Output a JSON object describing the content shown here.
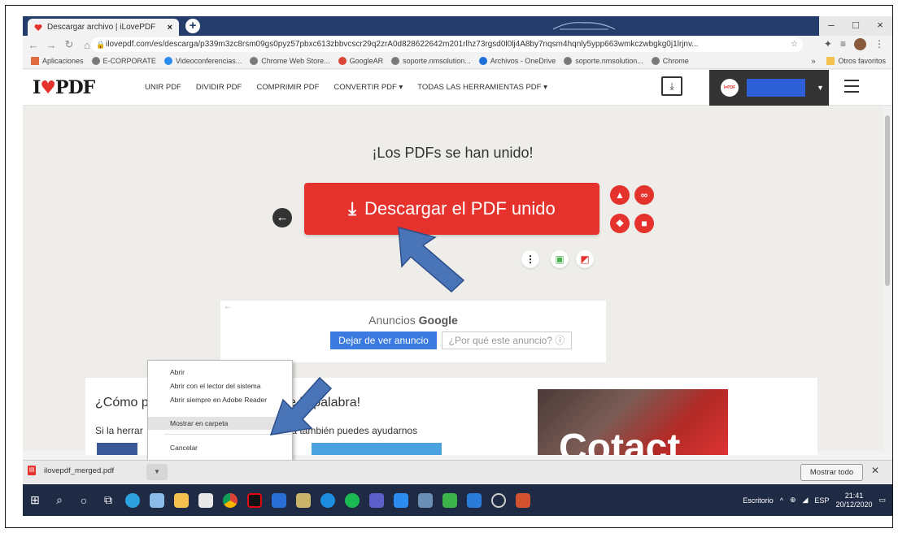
{
  "browser": {
    "tab_title": "Descargar archivo | iLovePDF",
    "new_tab": "+",
    "url": "ilovepdf.com/es/descarga/p339m3zc8rsm09gs0pyz57pbxc613zbbvcscr29q2zrA0d828622642m201rlhz73rgsd0l0lj4A8by7nqsm4hqnly5ypp663wmkczwbgkg0j1lrjnv...",
    "window_controls": {
      "min": "–",
      "max": "□",
      "close": "×"
    },
    "bookmarks": [
      "Aplicaciones",
      "E-CORPORATE",
      "Videoconferencias...",
      "Chrome Web Store...",
      "GoogleAR",
      "soporte.nmsolution...",
      "Archivos - OneDrive",
      "soporte.nmsolution...",
      "Chrome"
    ],
    "bookmarks_more": "»",
    "other_bookmarks": "Otros favoritos"
  },
  "site": {
    "logo_left": "I",
    "logo_heart": "♥",
    "logo_right": "PDF",
    "nav": [
      "UNIR PDF",
      "DIVIDIR PDF",
      "COMPRIMIR PDF",
      "CONVERTIR PDF ▾",
      "TODAS LAS HERRAMIENTAS PDF ▾"
    ],
    "avatar_text": "I♥PDF"
  },
  "main": {
    "heading": "¡Los PDFs se han unido!",
    "download_label": "Descargar el PDF unido",
    "download_icon": "⤓"
  },
  "ad": {
    "label_prefix": "Anuncios ",
    "label_brand": "Google",
    "stop_button": "Dejar de ver anuncio",
    "why_button": "¿Por qué este anuncio? ⓘ"
  },
  "card": {
    "heading_a": "¿Cómo p",
    "heading_b": "e la palabra!",
    "text_a": "Si la herrar",
    "text_b": "ta también puedes ayudarnos",
    "photo_text": "Cotact"
  },
  "context_menu": {
    "items": [
      "Abrir",
      "Abrir con el lector del sistema",
      "Abrir siempre en Adobe Reader",
      "Mostrar en carpeta",
      "Cancelar"
    ]
  },
  "download_shelf": {
    "filename": "ilovepdf_merged.pdf",
    "show_all": "Mostrar todo",
    "close": "✕"
  },
  "taskbar": {
    "desktop_label": "Escritorio",
    "language": "ESP",
    "time": "21:41",
    "date": "20/12/2020"
  },
  "colors": {
    "brand_red": "#e5322d",
    "titlebar": "#253d6b",
    "taskbar": "#1f2b45",
    "arrow_blue": "#4a74b8"
  }
}
